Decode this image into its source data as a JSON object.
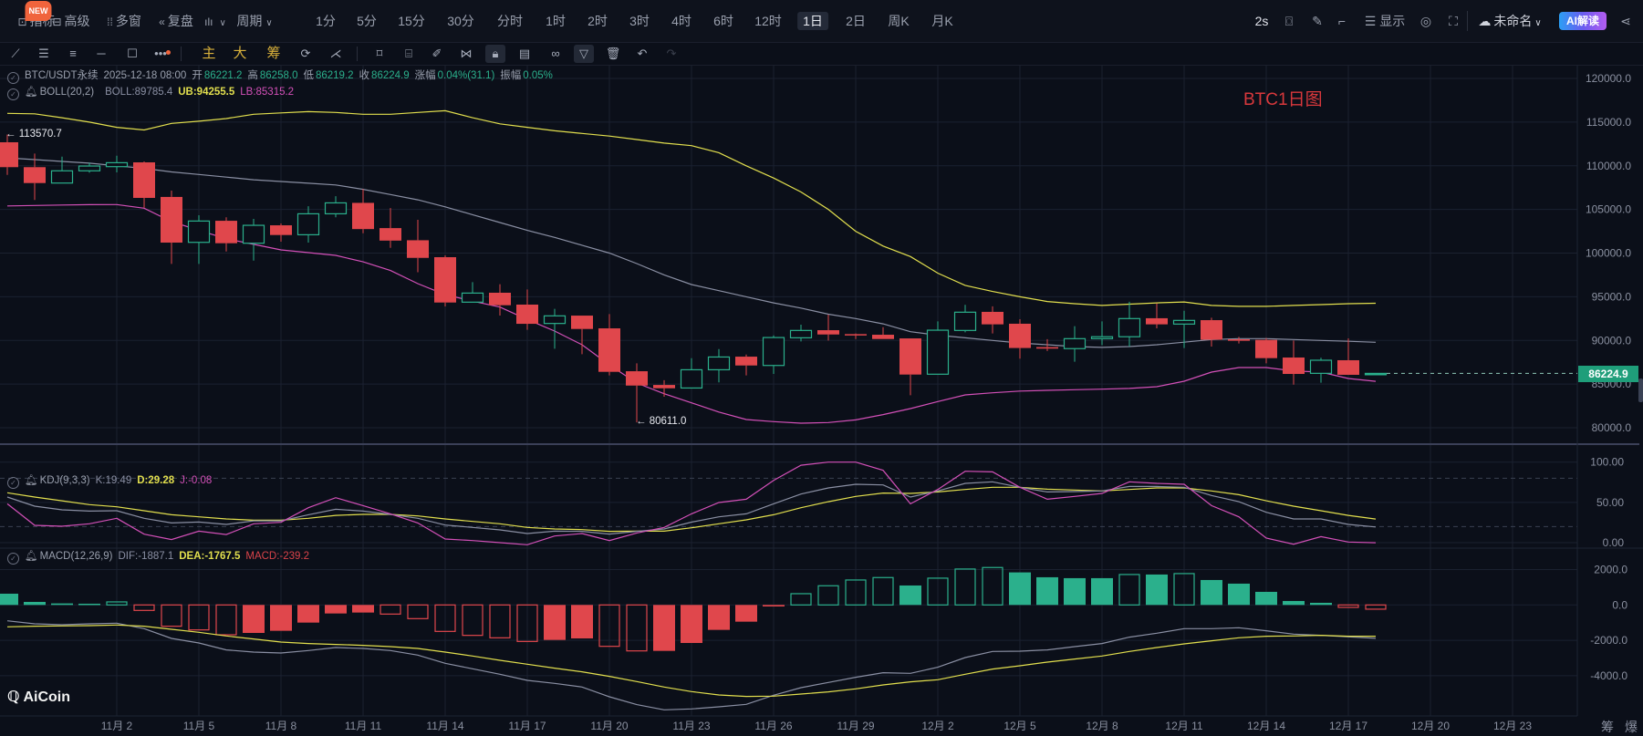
{
  "topbar": {
    "left_items": [
      {
        "icon": "indicator-icon",
        "label": "指标",
        "badge": "NEW"
      },
      {
        "icon": "advanced-icon",
        "label": "高级"
      },
      {
        "icon": "multi-window-icon",
        "label": "多窗"
      },
      {
        "icon": "replay-icon",
        "label": "复盘"
      },
      {
        "icon": "waveform-icon",
        "label": "",
        "chevron": true
      },
      {
        "label": "周期",
        "chevron": true
      }
    ],
    "intervals": [
      "1分",
      "5分",
      "15分",
      "30分",
      "分时",
      "1时",
      "2时",
      "3时",
      "4时",
      "6时",
      "12时",
      "1日",
      "2日",
      "周K",
      "月K"
    ],
    "active_interval": "1日",
    "right": {
      "refresh": "2s",
      "display_label": "显示",
      "layout_name": "未命名",
      "ai_label": "AI解读"
    }
  },
  "toolbar": {
    "tools": [
      "trend-line-icon",
      "parallel-channel-icon",
      "horizontal-lines-icon",
      "horizontal-ray-icon",
      "rectangle-icon",
      "more-tools-icon",
      "主",
      "大",
      "筹",
      "sync-drawing-icon",
      "magnet-icon",
      "bookmark-icon",
      "ruler-icon",
      "brush-icon",
      "pattern-icon",
      "lock-icon",
      "notes-icon",
      "link-icon",
      "filter-icon",
      "trash-icon",
      "undo-icon",
      "redo-icon"
    ]
  },
  "header_info": {
    "symbol": "BTC/USDT永续",
    "time": "2025-12-18 08:00",
    "fields": [
      {
        "label": "开",
        "value": "86221.2"
      },
      {
        "label": "高",
        "value": "86258.0"
      },
      {
        "label": "低",
        "value": "86219.2"
      },
      {
        "label": "收",
        "value": "86224.9"
      },
      {
        "label": "涨幅",
        "value": "0.04%(31.1)"
      },
      {
        "label": "振幅",
        "value": "0.05%"
      }
    ]
  },
  "watermark": "BTC1日图",
  "logo": "AiCoin",
  "bottom_right": [
    "筹",
    "爆"
  ],
  "colors": {
    "up": "#2bb08c",
    "down": "#e0474c",
    "boll_mid": "#8a8fa3",
    "boll_upper": "#e2df4e",
    "boll_lower": "#d350b8",
    "k": "#8a8fa3",
    "d": "#e2df4e",
    "j": "#d350b8",
    "dif": "#8a8fa3",
    "dea": "#e2df4e",
    "price_tag": "#1f9e7a"
  },
  "chart_data": {
    "type": "candlestick",
    "dates": [
      "2025-10-29",
      "2025-10-30",
      "2025-10-31",
      "2025-11-01",
      "2025-11-02",
      "2025-11-03",
      "2025-11-04",
      "2025-11-05",
      "2025-11-06",
      "2025-11-07",
      "2025-11-08",
      "2025-11-09",
      "2025-11-10",
      "2025-11-11",
      "2025-11-12",
      "2025-11-13",
      "2025-11-14",
      "2025-11-15",
      "2025-11-16",
      "2025-11-17",
      "2025-11-18",
      "2025-11-19",
      "2025-11-20",
      "2025-11-21",
      "2025-11-22",
      "2025-11-23",
      "2025-11-24",
      "2025-11-25",
      "2025-11-26",
      "2025-11-27",
      "2025-11-28",
      "2025-11-29",
      "2025-11-30",
      "2025-12-01",
      "2025-12-02",
      "2025-12-03",
      "2025-12-04",
      "2025-12-05",
      "2025-12-06",
      "2025-12-07",
      "2025-12-08",
      "2025-12-09",
      "2025-12-10",
      "2025-12-11",
      "2025-12-12",
      "2025-12-13",
      "2025-12-14",
      "2025-12-15",
      "2025-12-16",
      "2025-12-17",
      "2025-12-18"
    ],
    "ohlc": [
      [
        112690,
        113570.7,
        108960,
        109840
      ],
      [
        109840,
        111400,
        106080,
        108020
      ],
      [
        108020,
        111050,
        108020,
        109420
      ],
      [
        109420,
        110350,
        109200,
        109970
      ],
      [
        109900,
        111150,
        109240,
        110350
      ],
      [
        110390,
        110500,
        105180,
        106320
      ],
      [
        106430,
        107150,
        98760,
        101200
      ],
      [
        101230,
        104330,
        98760,
        103670
      ],
      [
        103700,
        104100,
        100180,
        101130
      ],
      [
        101130,
        103910,
        99140,
        103180
      ],
      [
        103180,
        103390,
        101300,
        102070
      ],
      [
        102100,
        105370,
        101200,
        104500
      ],
      [
        104500,
        106520,
        104100,
        105750
      ],
      [
        105750,
        107330,
        102270,
        102750
      ],
      [
        102860,
        105160,
        100600,
        101430
      ],
      [
        101470,
        103810,
        97810,
        99450
      ],
      [
        99530,
        99740,
        93890,
        94340
      ],
      [
        94380,
        96670,
        94380,
        95420
      ],
      [
        95460,
        96430,
        92840,
        94030
      ],
      [
        94100,
        95840,
        91220,
        91900
      ],
      [
        91940,
        93620,
        89050,
        92810
      ],
      [
        92840,
        92840,
        88420,
        91310
      ],
      [
        91380,
        93020,
        85990,
        86400
      ],
      [
        86470,
        87370,
        80611,
        84830
      ],
      [
        84900,
        85450,
        83550,
        84520
      ],
      [
        84550,
        87960,
        84550,
        86640
      ],
      [
        86640,
        89010,
        85190,
        88100
      ],
      [
        88140,
        88380,
        85990,
        87130
      ],
      [
        87130,
        90580,
        86160,
        90330
      ],
      [
        90300,
        91800,
        89880,
        91140
      ],
      [
        91170,
        92950,
        89990,
        90680
      ],
      [
        90720,
        90800,
        90160,
        90580
      ],
      [
        90650,
        91520,
        90160,
        90160
      ],
      [
        90230,
        90230,
        83720,
        86090
      ],
      [
        86130,
        92180,
        86130,
        91170
      ],
      [
        91140,
        94070,
        90930,
        93230
      ],
      [
        93270,
        93900,
        90790,
        91840
      ],
      [
        91910,
        92430,
        87910,
        89130
      ],
      [
        89230,
        90140,
        88780,
        89060
      ],
      [
        89060,
        91630,
        87560,
        90200
      ],
      [
        90200,
        92180,
        89470,
        90420
      ],
      [
        90420,
        94420,
        89300,
        92500
      ],
      [
        92540,
        94240,
        91390,
        91840
      ],
      [
        91870,
        93400,
        89130,
        92290
      ],
      [
        92320,
        92600,
        89300,
        90080
      ],
      [
        90130,
        90410,
        89650,
        89960
      ],
      [
        90060,
        90270,
        87380,
        87970
      ],
      [
        88040,
        89990,
        84940,
        86160
      ],
      [
        86230,
        88010,
        85160,
        87730
      ],
      [
        87730,
        90240,
        86060,
        86060
      ],
      [
        86221.2,
        86258.0,
        86219.2,
        86224.9
      ]
    ],
    "last_price": "86224.9",
    "high_marker": "113570.7",
    "low_marker": "80611.0",
    "price_axis": {
      "ticks": [
        "120000.0",
        "115000.0",
        "110000.0",
        "105000.0",
        "100000.0",
        "95000.0",
        "90000.0",
        "85000.0",
        "80000.0"
      ],
      "range": [
        80000,
        120000
      ]
    },
    "date_ticks": [
      {
        "date": "2025-11-02",
        "label": "11月 2"
      },
      {
        "date": "2025-11-05",
        "label": "11月 5"
      },
      {
        "date": "2025-11-08",
        "label": "11月 8"
      },
      {
        "date": "2025-11-11",
        "label": "11月 11"
      },
      {
        "date": "2025-11-14",
        "label": "11月 14"
      },
      {
        "date": "2025-11-17",
        "label": "11月 17"
      },
      {
        "date": "2025-11-20",
        "label": "11月 20"
      },
      {
        "date": "2025-11-23",
        "label": "11月 23"
      },
      {
        "date": "2025-11-26",
        "label": "11月 26"
      },
      {
        "date": "2025-11-29",
        "label": "11月 29"
      },
      {
        "date": "2025-12-02",
        "label": "12月 2"
      },
      {
        "date": "2025-12-05",
        "label": "12月 5"
      },
      {
        "date": "2025-12-08",
        "label": "12月 8"
      },
      {
        "date": "2025-12-11",
        "label": "12月 11"
      },
      {
        "date": "2025-12-14",
        "label": "12月 14"
      },
      {
        "date": "2025-12-17",
        "label": "12月 17"
      },
      {
        "date": "2025-12-20",
        "label": "12月 20"
      },
      {
        "date": "2025-12-23",
        "label": "12月 23"
      }
    ],
    "boll": {
      "title": "BOLL(20,2)",
      "legend": [
        "BOLL:89785.4",
        "UB:94255.5",
        "LB:85315.2"
      ],
      "mid": [
        110900,
        110700,
        110500,
        110300,
        110000,
        109700,
        109300,
        109000,
        108700,
        108400,
        108200,
        108000,
        107800,
        107300,
        106700,
        106100,
        105300,
        104400,
        103500,
        102600,
        101800,
        100900,
        100000,
        98800,
        97500,
        96400,
        95700,
        95000,
        94300,
        93700,
        93000,
        92500,
        91900,
        91000,
        90600,
        90300,
        90000,
        89700,
        89500,
        89300,
        89200,
        89300,
        89500,
        89800,
        90100,
        90200,
        90200,
        90100,
        90000,
        89900,
        89785.4
      ],
      "upper": [
        116000,
        115950,
        115500,
        115000,
        114400,
        114100,
        114850,
        115100,
        115400,
        115900,
        116050,
        116200,
        116100,
        115900,
        115900,
        116100,
        116300,
        115500,
        114800,
        114400,
        114000,
        113700,
        113400,
        113000,
        112600,
        112300,
        111500,
        110000,
        108600,
        107000,
        105000,
        102500,
        100800,
        99600,
        97700,
        96300,
        95600,
        95000,
        94450,
        94200,
        94000,
        94150,
        94300,
        94400,
        94000,
        93900,
        93900,
        94000,
        94100,
        94200,
        94255.5
      ],
      "lower": [
        105400,
        105450,
        105500,
        105550,
        105560,
        105140,
        103600,
        102600,
        101650,
        101000,
        100370,
        100050,
        99740,
        99000,
        98000,
        96500,
        95250,
        94500,
        93820,
        92400,
        91070,
        89500,
        87200,
        85120,
        83900,
        82850,
        81800,
        80940,
        80700,
        80520,
        80600,
        80900,
        81500,
        82190,
        83000,
        83760,
        84000,
        84200,
        84280,
        84350,
        84420,
        84500,
        84700,
        85330,
        86370,
        86890,
        86890,
        86510,
        86370,
        85640,
        85315.2
      ]
    },
    "kdj": {
      "title": "KDJ(9,3,3)",
      "legend": [
        "K:19.49",
        "D:29.28",
        "J:-0.08"
      ],
      "axis_ticks": [
        "100.00",
        "50.00",
        "0.00"
      ],
      "k": [
        56.6,
        45.3,
        40.8,
        39.2,
        39.6,
        30.2,
        24.5,
        25.6,
        22.6,
        27.1,
        27.1,
        34.7,
        41.5,
        39.2,
        35.1,
        30.2,
        21.9,
        18.9,
        15.8,
        11.3,
        14.3,
        14.0,
        10.6,
        14.0,
        17.0,
        25.5,
        32.0,
        35.8,
        48.3,
        60.4,
        67.9,
        72.5,
        71.7,
        56.6,
        64.2,
        73.6,
        75.5,
        68.7,
        63.0,
        63.4,
        64.2,
        69.8,
        69.8,
        68.7,
        58.5,
        50.9,
        37.7,
        29.4,
        29.4,
        22.6,
        19.49
      ],
      "d": [
        62.0,
        56.6,
        52.0,
        47.2,
        44.5,
        39.6,
        34.7,
        32.0,
        29.4,
        27.9,
        27.9,
        30.2,
        33.9,
        35.1,
        35.1,
        33.2,
        29.4,
        26.4,
        23.4,
        18.9,
        17.0,
        16.2,
        14.0,
        14.3,
        14.3,
        18.5,
        23.4,
        28.3,
        34.7,
        43.4,
        50.9,
        57.4,
        61.6,
        61.1,
        63.0,
        66.0,
        68.7,
        68.7,
        66.4,
        65.3,
        64.2,
        66.0,
        67.9,
        67.9,
        64.2,
        59.6,
        52.0,
        45.3,
        39.6,
        33.9,
        29.28
      ],
      "j": [
        48.3,
        21.5,
        20.4,
        23.4,
        30.2,
        10.5,
        3.8,
        14.3,
        10.1,
        23.4,
        25.3,
        43.4,
        55.8,
        46.0,
        35.8,
        24.5,
        4.5,
        2.6,
        0.0,
        -2.6,
        8.3,
        11.3,
        2.6,
        12.0,
        18.9,
        35.8,
        49.8,
        53.9,
        77.3,
        96.2,
        100.0,
        100.0,
        89.8,
        48.3,
        66.0,
        88.7,
        87.9,
        68.7,
        53.9,
        57.4,
        61.1,
        75.5,
        73.6,
        72.5,
        46.0,
        32.0,
        5.7,
        -1.9,
        7.5,
        0.8,
        -0.08
      ]
    },
    "macd": {
      "title": "MACD(12,26,9)",
      "legend": [
        "DIF:-1887.1",
        "DEA:-1767.5",
        "MACD:-239.2"
      ],
      "axis_ticks": [
        "2000.0",
        "0.0",
        "-2000.0",
        "-4000.0"
      ],
      "dif": [
        -895,
        -1067,
        -1119,
        -1067,
        -1032,
        -1340,
        -1890,
        -2148,
        -2543,
        -2663,
        -2715,
        -2578,
        -2406,
        -2457,
        -2578,
        -2835,
        -3299,
        -3608,
        -3918,
        -4261,
        -4433,
        -4639,
        -5189,
        -5636,
        -5928,
        -5876,
        -5756,
        -5618,
        -5103,
        -4674,
        -4381,
        -4089,
        -3832,
        -3866,
        -3522,
        -2973,
        -2629,
        -2612,
        -2543,
        -2354,
        -2182,
        -1822,
        -1598,
        -1340,
        -1340,
        -1289,
        -1460,
        -1650,
        -1718,
        -1804,
        -1887.1
      ],
      "dea": [
        -1237,
        -1203,
        -1186,
        -1168,
        -1134,
        -1203,
        -1375,
        -1546,
        -1753,
        -1925,
        -2096,
        -2182,
        -2234,
        -2285,
        -2354,
        -2457,
        -2663,
        -2887,
        -3127,
        -3351,
        -3574,
        -3780,
        -4038,
        -4330,
        -4639,
        -4897,
        -5086,
        -5171,
        -5154,
        -5034,
        -4914,
        -4742,
        -4519,
        -4347,
        -4227,
        -3918,
        -3626,
        -3437,
        -3231,
        -3059,
        -2887,
        -2629,
        -2406,
        -2199,
        -2027,
        -1856,
        -1770,
        -1753,
        -1718,
        -1770,
        -1767.5
      ],
      "hist": [
        636,
        172,
        86,
        69,
        172,
        -310,
        -1204,
        -1410,
        -1686,
        -1582,
        -1462,
        -998,
        -482,
        -430,
        -516,
        -774,
        -1496,
        -1720,
        -1858,
        -2064,
        -1978,
        -1892,
        -2339,
        -2597,
        -2597,
        -2150,
        -1410,
        -946,
        -86,
        636,
        1084,
        1410,
        1548,
        1100,
        1514,
        2030,
        2116,
        1840,
        1565,
        1514,
        1514,
        1720,
        1720,
        1772,
        1410,
        1204,
        740,
        224,
        120,
        -138,
        -239.2
      ]
    }
  }
}
